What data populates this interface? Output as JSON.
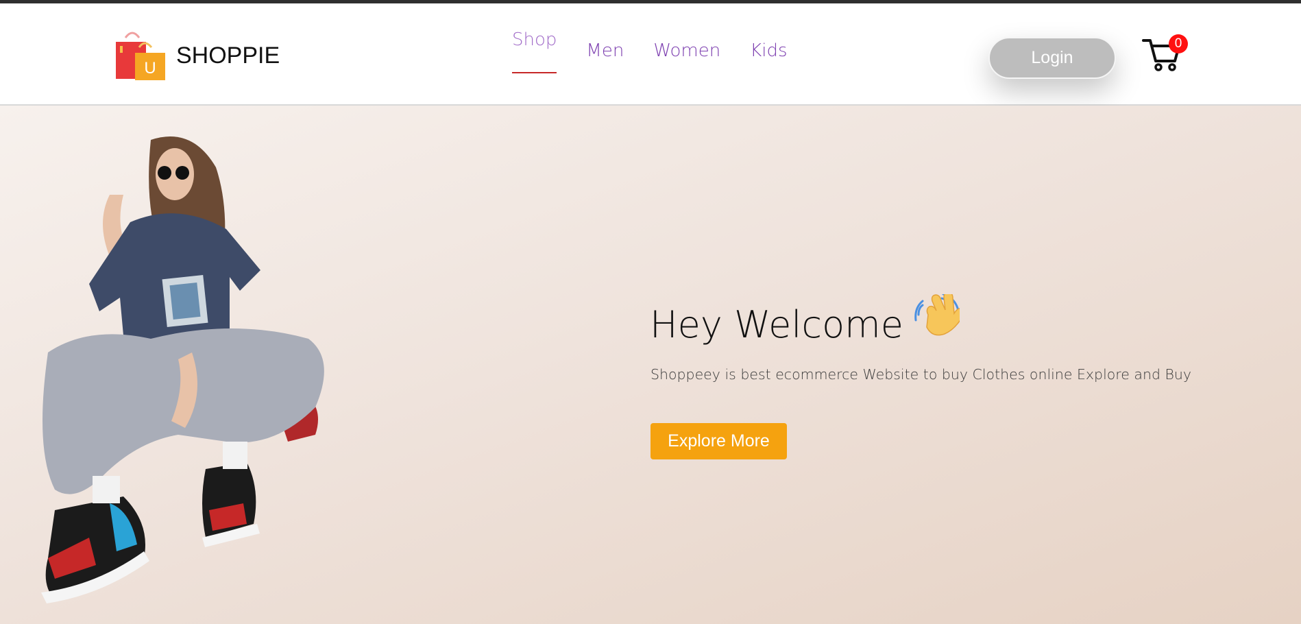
{
  "brand": {
    "name": "SHOPPIE",
    "logo_letter": "U"
  },
  "nav": {
    "items": [
      {
        "label": "Shop",
        "active": true
      },
      {
        "label": "Men",
        "active": false
      },
      {
        "label": "Women",
        "active": false
      },
      {
        "label": "Kids",
        "active": false
      }
    ]
  },
  "header": {
    "login_label": "Login",
    "cart_count": "0",
    "cart_icon": "shopping-cart-icon"
  },
  "hero": {
    "title": "Hey Welcome",
    "emoji_icon": "waving-hand-icon",
    "description": "Shoppeey is best ecommerce Website to buy Clothes online Explore and Buy",
    "cta_label": "Explore More"
  },
  "colors": {
    "accent_orange": "#f5a20f",
    "nav_purple": "#7d3fb0",
    "active_underline": "#c62828",
    "badge_red": "#ff1010",
    "login_gray": "#bdbdbd"
  }
}
